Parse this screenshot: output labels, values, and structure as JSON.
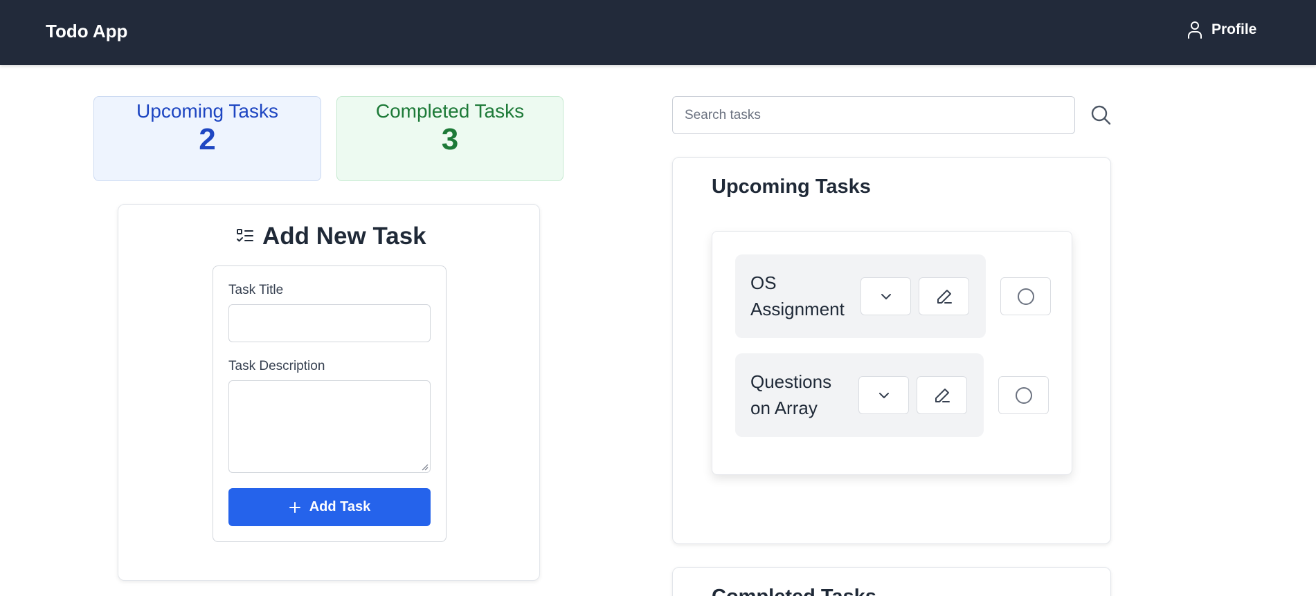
{
  "navbar": {
    "brand": "Todo App",
    "profile_label": "Profile",
    "profile_icon": "user-icon",
    "background": "#222a3a"
  },
  "stats": {
    "upcoming": {
      "label": "Upcoming Tasks",
      "count": "2",
      "color": "#1e46c2"
    },
    "completed": {
      "label": "Completed Tasks",
      "count": "3",
      "color": "#1d7a38"
    }
  },
  "add_task": {
    "heading": "Add New Task",
    "heading_icon": "task-list-icon",
    "title_label": "Task Title",
    "title_value": "",
    "description_label": "Task Description",
    "description_value": "",
    "button_label": "Add Task",
    "button_icon": "plus-icon",
    "button_color": "#2563eb"
  },
  "search": {
    "placeholder": "Search tasks",
    "value": "",
    "icon": "search-icon"
  },
  "upcoming_section": {
    "title": "Upcoming Tasks",
    "tasks": [
      {
        "title_line1": "OS",
        "title_line2": "Assignment",
        "expand_icon": "chevron-down-icon",
        "edit_icon": "pencil-icon",
        "complete_icon": "circle-icon"
      },
      {
        "title_line1": "Questions",
        "title_line2": "on Array",
        "expand_icon": "chevron-down-icon",
        "edit_icon": "pencil-icon",
        "complete_icon": "circle-icon"
      }
    ]
  },
  "completed_section": {
    "title": "Completed Tasks"
  }
}
